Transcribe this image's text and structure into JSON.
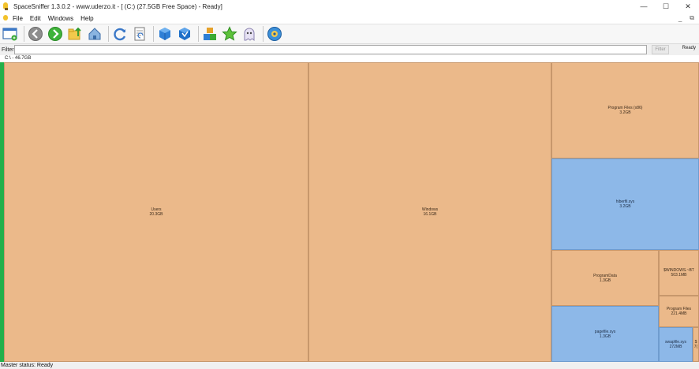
{
  "window": {
    "title": "SpaceSniffer 1.3.0.2 - www.uderzo.it - [ (C:) (27.5GB Free Space) - Ready]",
    "minimize_label": "—",
    "maximize_label": "☐",
    "close_label": "✕"
  },
  "menu": {
    "items": [
      "File",
      "Edit",
      "Windows",
      "Help"
    ],
    "mdi_minimize": "_",
    "mdi_restore": "⧉"
  },
  "toolbar": {
    "buttons": [
      "new-scan-icon",
      "back-icon",
      "forward-icon",
      "folder-up-icon",
      "home-icon",
      "refresh-icon",
      "report-icon",
      "box-blue-icon",
      "box-shield-icon",
      "cubes-icon",
      "star-icon",
      "ghost-icon",
      "settings-icon"
    ]
  },
  "filter": {
    "label": "Filter",
    "value": "",
    "button_label": "Filter",
    "status": "Ready"
  },
  "path": {
    "text": "C:\\ - 46.7GB"
  },
  "tiles": [
    {
      "name": "Users",
      "size": "20.3GB",
      "color": "brown"
    },
    {
      "name": "Windows",
      "size": "16.1GB",
      "color": "brown"
    },
    {
      "name": "Program Files (x86)",
      "size": "3.2GB",
      "color": "brown"
    },
    {
      "name": "hiberfil.sys",
      "size": "3.2GB",
      "color": "blue"
    },
    {
      "name": "ProgramData",
      "size": "1.3GB",
      "color": "brown"
    },
    {
      "name": "$WINDOWS.~BT",
      "size": "503.1MB",
      "color": "brown"
    },
    {
      "name": "Program Files",
      "size": "221.4MB",
      "color": "brown"
    },
    {
      "name": "pagefile.sys",
      "size": "1.3GB",
      "color": "blue"
    },
    {
      "name": "swapfile.sys",
      "size": "272MB",
      "color": "blue"
    },
    {
      "name": "$",
      "size": "7(",
      "color": "brown"
    }
  ],
  "status": {
    "text": "Master status: Ready"
  },
  "colors": {
    "tile_brown": "#ebb98a",
    "tile_blue": "#8db8e8",
    "accent_green": "#22b04a"
  }
}
